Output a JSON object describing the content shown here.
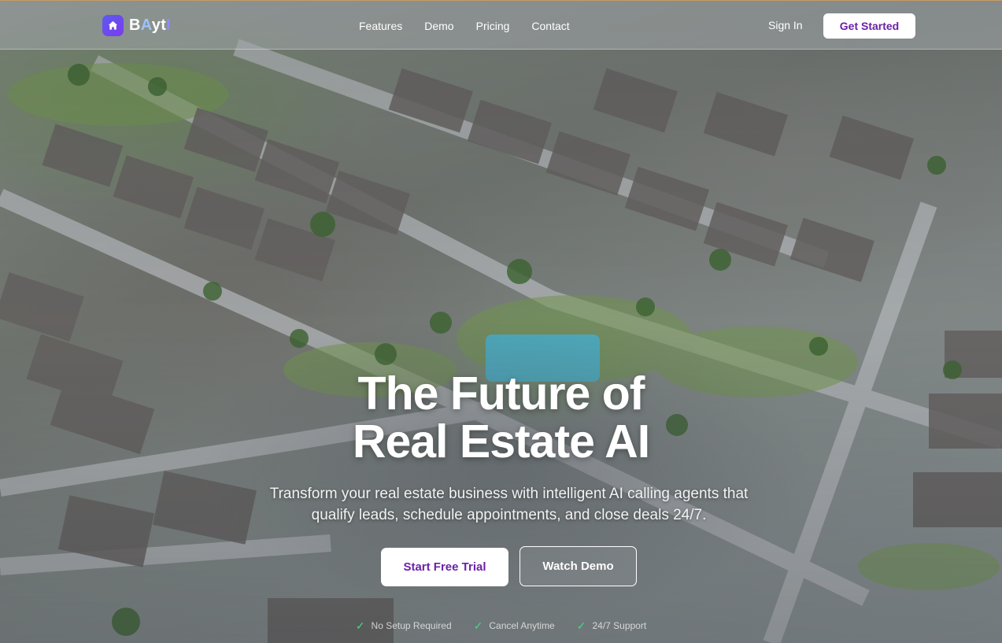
{
  "brand": {
    "name_parts": [
      "B",
      "A",
      "yt",
      "I"
    ],
    "icon": "home-icon",
    "accent": "#6d4aff"
  },
  "nav": {
    "links": [
      "Features",
      "Demo",
      "Pricing",
      "Contact"
    ],
    "sign_in": "Sign In",
    "get_started": "Get Started"
  },
  "hero": {
    "title_line1": "The Future of",
    "title_line2": "Real Estate AI",
    "subtitle": "Transform your real estate business with intelligent AI calling agents that qualify leads, schedule appointments, and close deals 24/7.",
    "primary_cta": "Start Free Trial",
    "secondary_cta": "Watch Demo",
    "features": [
      "No Setup Required",
      "Cancel Anytime",
      "24/7 Support"
    ],
    "check_icon": "check-icon",
    "check_color": "#3ddc84"
  },
  "colors": {
    "button_text": "#6b21a8",
    "nav_border_top": "#c69b63"
  }
}
